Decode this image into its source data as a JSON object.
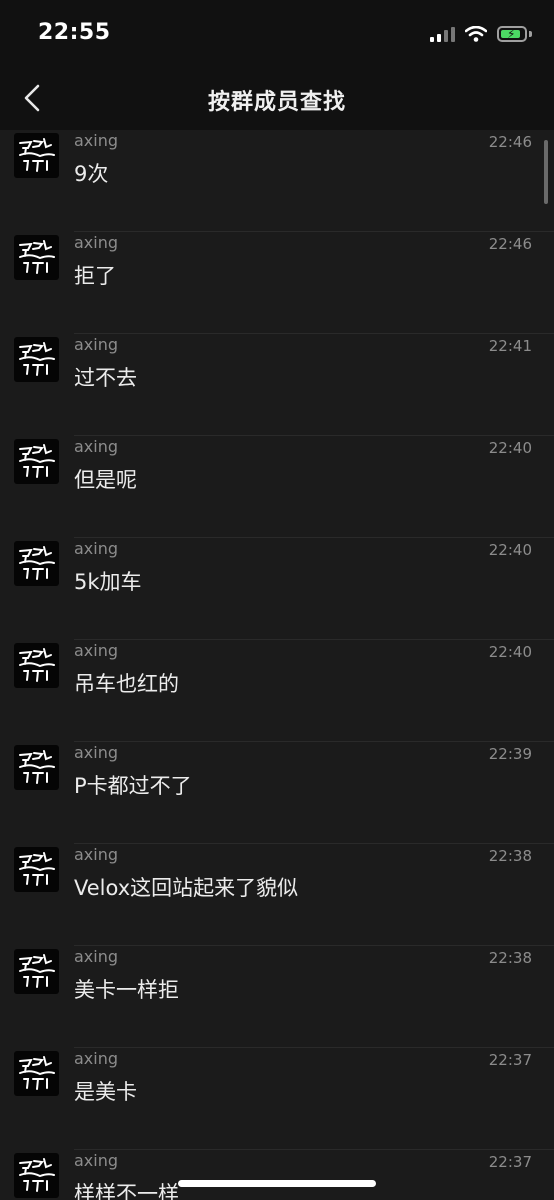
{
  "status": {
    "time": "22:55"
  },
  "nav": {
    "title": "按群成员查找"
  },
  "messages": [
    {
      "sender": "axing",
      "time": "22:46",
      "text": "9次"
    },
    {
      "sender": "axing",
      "time": "22:46",
      "text": "拒了"
    },
    {
      "sender": "axing",
      "time": "22:41",
      "text": "过不去"
    },
    {
      "sender": "axing",
      "time": "22:40",
      "text": "但是呢"
    },
    {
      "sender": "axing",
      "time": "22:40",
      "text": "5k加车"
    },
    {
      "sender": "axing",
      "time": "22:40",
      "text": "吊车也红的"
    },
    {
      "sender": "axing",
      "time": "22:39",
      "text": "P卡都过不了"
    },
    {
      "sender": "axing",
      "time": "22:38",
      "text": "Velox这回站起来了貌似"
    },
    {
      "sender": "axing",
      "time": "22:38",
      "text": "美卡一样拒"
    },
    {
      "sender": "axing",
      "time": "22:37",
      "text": "是美卡"
    },
    {
      "sender": "axing",
      "time": "22:37",
      "text": "样样不一样"
    }
  ],
  "colors": {
    "background": "#1b1b1b",
    "bar": "#111111",
    "battery": "#4cd964"
  },
  "icons": {
    "back": "chevron-left-icon",
    "wifi": "wifi-icon",
    "signal": "cellular-signal-icon",
    "battery": "battery-charging-icon"
  }
}
